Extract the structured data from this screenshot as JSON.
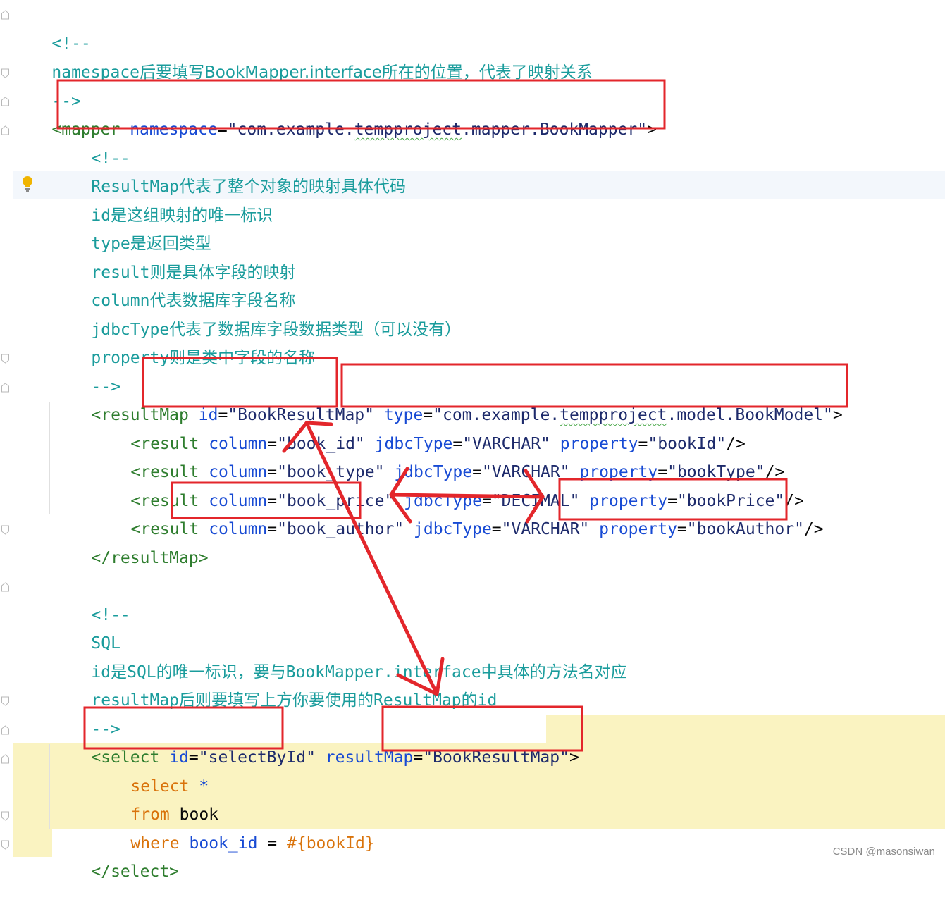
{
  "editor": {
    "comment_open": "<!--",
    "comment_close": "-->",
    "comment1": {
      "word": "namespace",
      "text": "后要填写BookMapper.interface所在的位置，代表了映射关系"
    },
    "mapper_open": {
      "tag": "<mapper",
      "attr": "namespace",
      "eq": "=",
      "value_prefix": "\"com.example.",
      "value_squiggle": "tempproject",
      "value_suffix": ".mapper.BookMapper\"",
      "close": ">"
    },
    "comment2": [
      {
        "word": "ResultMap",
        "text": "代表了整个对象的映射具体代码"
      },
      {
        "word": "id",
        "text": "是这组映射的唯一标识"
      },
      {
        "word": "type",
        "text": "是返回类型"
      },
      {
        "word": "result",
        "text": "则是具体字段的映射"
      },
      {
        "word": "column",
        "text": "代表数据库字段名称"
      },
      {
        "word": "jdbcType",
        "text": "代表了数据库字段数据类型（可以没有）"
      },
      {
        "word": "property",
        "text": "则是类中字段的名称"
      }
    ],
    "resultmap_open": {
      "tag": "<resultMap",
      "id_attr": "id",
      "id_value": "\"BookResultMap\"",
      "type_attr": "type",
      "type_prefix": "\"com.example.",
      "type_squiggle": "tempproject",
      "type_suffix": ".model.BookModel\"",
      "close": ">"
    },
    "results": [
      {
        "tag": "<result",
        "column": "\"book_id\"",
        "jdbc": "\"VARCHAR\"",
        "property": "\"bookId\"",
        "close": "/>"
      },
      {
        "tag": "<result",
        "column": "\"book_type\"",
        "jdbc": "\"VARCHAR\"",
        "property": "\"bookType\"",
        "close": "/>"
      },
      {
        "tag": "<result",
        "column": "\"book_price\"",
        "jdbc": "\"DECIMAL\"",
        "property": "\"bookPrice\"",
        "close": "/>"
      },
      {
        "tag": "<result",
        "column": "\"book_author\"",
        "jdbc": "\"VARCHAR\"",
        "property": "\"bookAuthor\"",
        "close": "/>"
      }
    ],
    "attr_names": {
      "column": "column",
      "jdbc": "jdbcType",
      "property": "property",
      "eq": "="
    },
    "resultmap_close": "</resultMap>",
    "comment3": {
      "sql": "SQL",
      "line2_word": "id",
      "line2_mid": "是",
      "line2_sql": "SQL",
      "line2_text": "的唯一标识，要与",
      "line2_word2": "BookMapper.interface",
      "line2_text2": "中具体的方法名对应",
      "line3_word": "resultMap",
      "line3_text": "后则要填写上方你要使用的",
      "line3_word2": "ResultMap",
      "line3_mid": "的",
      "line3_word3": "id"
    },
    "select_open": {
      "tag": "<select",
      "id_attr": "id",
      "id_value": "\"selectById\"",
      "rm_attr": "resultMap",
      "rm_value": "\"BookResultMap\"",
      "close": ">"
    },
    "sql": {
      "select_kw": "select",
      "star": "*",
      "from_kw": "from",
      "table": "book",
      "where_kw": "where",
      "col": "book_id",
      "op": "=",
      "param": "#{bookId}"
    },
    "select_close": "</select>"
  },
  "watermark": "CSDN @masonsiwan",
  "colors": {
    "comment": "#1a9c9c",
    "tag": "#2e7d2e",
    "attribute": "#174ad4",
    "string": "#1d2a6b",
    "keyword": "#d9730b",
    "selection": "#faf3c1",
    "annotation": "#e3262b"
  }
}
